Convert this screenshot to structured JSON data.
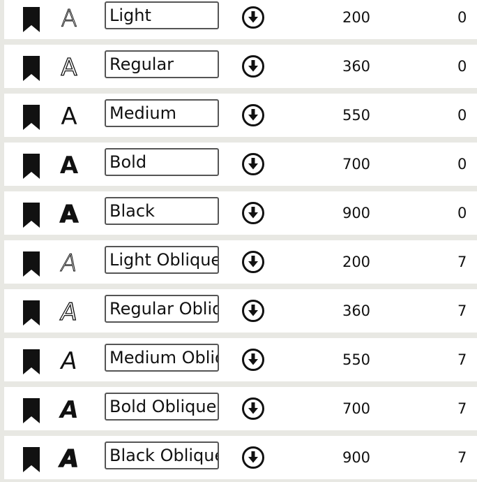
{
  "rows": [
    {
      "name": "Light",
      "weight": "200",
      "slant": "0",
      "glyph": "A",
      "oblique": false
    },
    {
      "name": "Regular",
      "weight": "360",
      "slant": "0",
      "glyph": "A",
      "oblique": false
    },
    {
      "name": "Medium",
      "weight": "550",
      "slant": "0",
      "glyph": "A",
      "oblique": false
    },
    {
      "name": "Bold",
      "weight": "700",
      "slant": "0",
      "glyph": "A",
      "oblique": false
    },
    {
      "name": "Black",
      "weight": "900",
      "slant": "0",
      "glyph": "A",
      "oblique": false
    },
    {
      "name": "Light Oblique",
      "weight": "200",
      "slant": "7",
      "glyph": "A",
      "oblique": true
    },
    {
      "name": "Regular Oblique",
      "weight": "360",
      "slant": "7",
      "glyph": "A",
      "oblique": true
    },
    {
      "name": "Medium Oblique",
      "weight": "550",
      "slant": "7",
      "glyph": "A",
      "oblique": true
    },
    {
      "name": "Bold Oblique",
      "weight": "700",
      "slant": "7",
      "glyph": "A",
      "oblique": true
    },
    {
      "name": "Black Oblique",
      "weight": "900",
      "slant": "7",
      "glyph": "A",
      "oblique": true
    }
  ],
  "icons": {
    "bookmark": "bookmark-icon",
    "download": "download-circle-icon"
  },
  "colors": {
    "background": "#e8e8e3",
    "row": "#ffffff",
    "foreground": "#111111",
    "field_border": "#555555"
  }
}
